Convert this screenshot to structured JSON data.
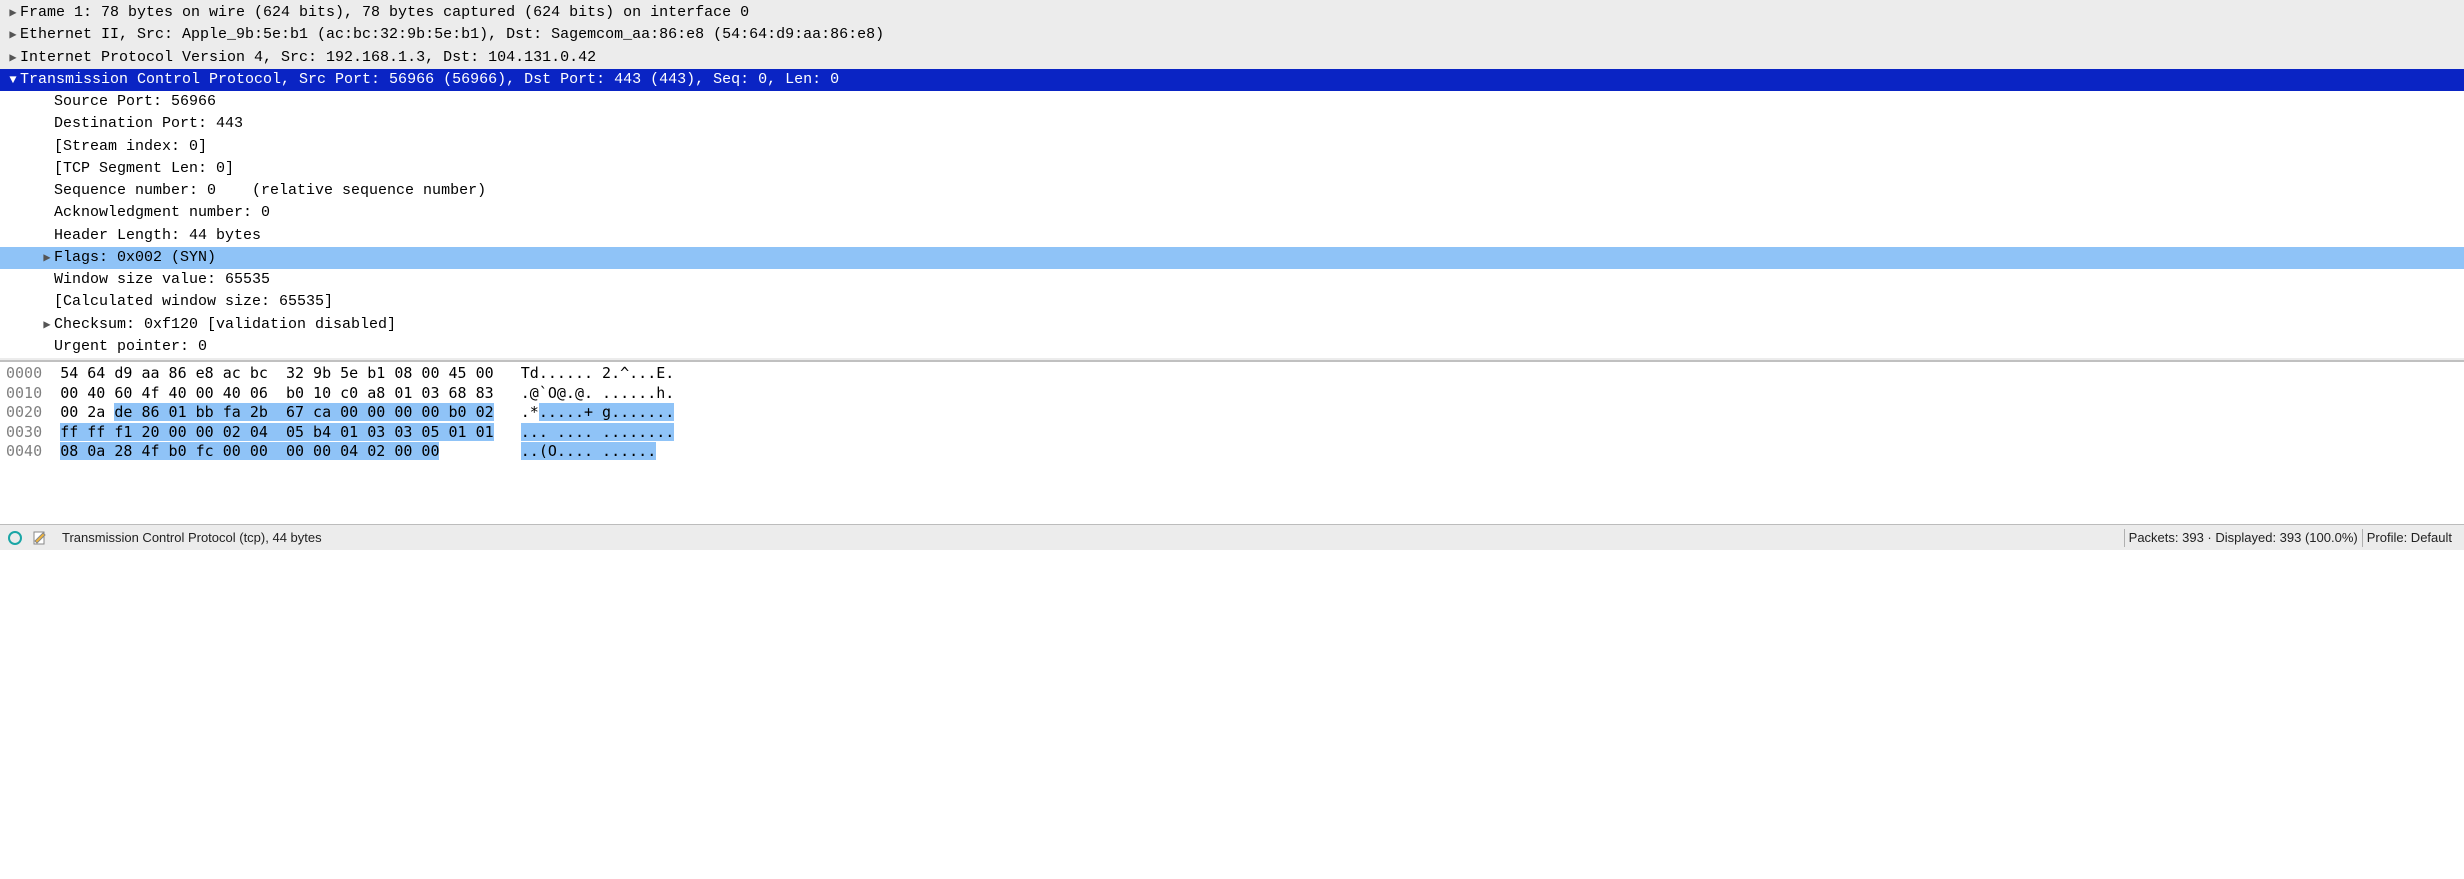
{
  "details": {
    "frame": "Frame 1: 78 bytes on wire (624 bits), 78 bytes captured (624 bits) on interface 0",
    "ethernet": "Ethernet II, Src: Apple_9b:5e:b1 (ac:bc:32:9b:5e:b1), Dst: Sagemcom_aa:86:e8 (54:64:d9:aa:86:e8)",
    "ip": "Internet Protocol Version 4, Src: 192.168.1.3, Dst: 104.131.0.42",
    "tcp": "Transmission Control Protocol, Src Port: 56966 (56966), Dst Port: 443 (443), Seq: 0, Len: 0",
    "tcp_fields": {
      "src_port": "Source Port: 56966",
      "dst_port": "Destination Port: 443",
      "stream": "[Stream index: 0]",
      "seg_len": "[TCP Segment Len: 0]",
      "seq": "Sequence number: 0    (relative sequence number)",
      "ack": "Acknowledgment number: 0",
      "hdr_len": "Header Length: 44 bytes",
      "flags": "Flags: 0x002 (SYN)",
      "win": "Window size value: 65535",
      "calc_win": "[Calculated window size: 65535]",
      "checksum": "Checksum: 0xf120 [validation disabled]",
      "urgent": "Urgent pointer: 0"
    }
  },
  "hex": {
    "rows": [
      {
        "offset": "0000",
        "plain1": "54 64 d9 aa 86 e8 ac bc  32 9b 5e b1 08 00 45 00",
        "sel1": "",
        "plain_ascii": "Td...... 2.^...E.",
        "sel_ascii": ""
      },
      {
        "offset": "0010",
        "plain1": "00 40 60 4f 40 00 40 06  b0 10 c0 a8 01 03 68 83",
        "sel1": "",
        "plain_ascii": ".@`O@.@. ......h.",
        "sel_ascii": ""
      },
      {
        "offset": "0020",
        "plain1": "00 2a ",
        "sel1": "de 86 01 bb fa 2b  67 ca 00 00 00 00 b0 02",
        "plain_ascii": ".*",
        "sel_ascii": ".....+ g......."
      },
      {
        "offset": "0030",
        "plain1": "",
        "sel1": "ff ff f1 20 00 00 02 04  05 b4 01 03 03 05 01 01",
        "plain_ascii": "",
        "sel_ascii": "... .... ........"
      },
      {
        "offset": "0040",
        "plain1": "",
        "sel1": "08 0a 28 4f b0 fc 00 00  00 00 04 02 00 00",
        "plain_ascii": "",
        "sel_ascii": "..(O.... ......"
      }
    ]
  },
  "status": {
    "field": "Transmission Control Protocol (tcp), 44 bytes",
    "packets": "Packets: 393 · Displayed: 393 (100.0%)",
    "profile": "Profile: Default"
  }
}
